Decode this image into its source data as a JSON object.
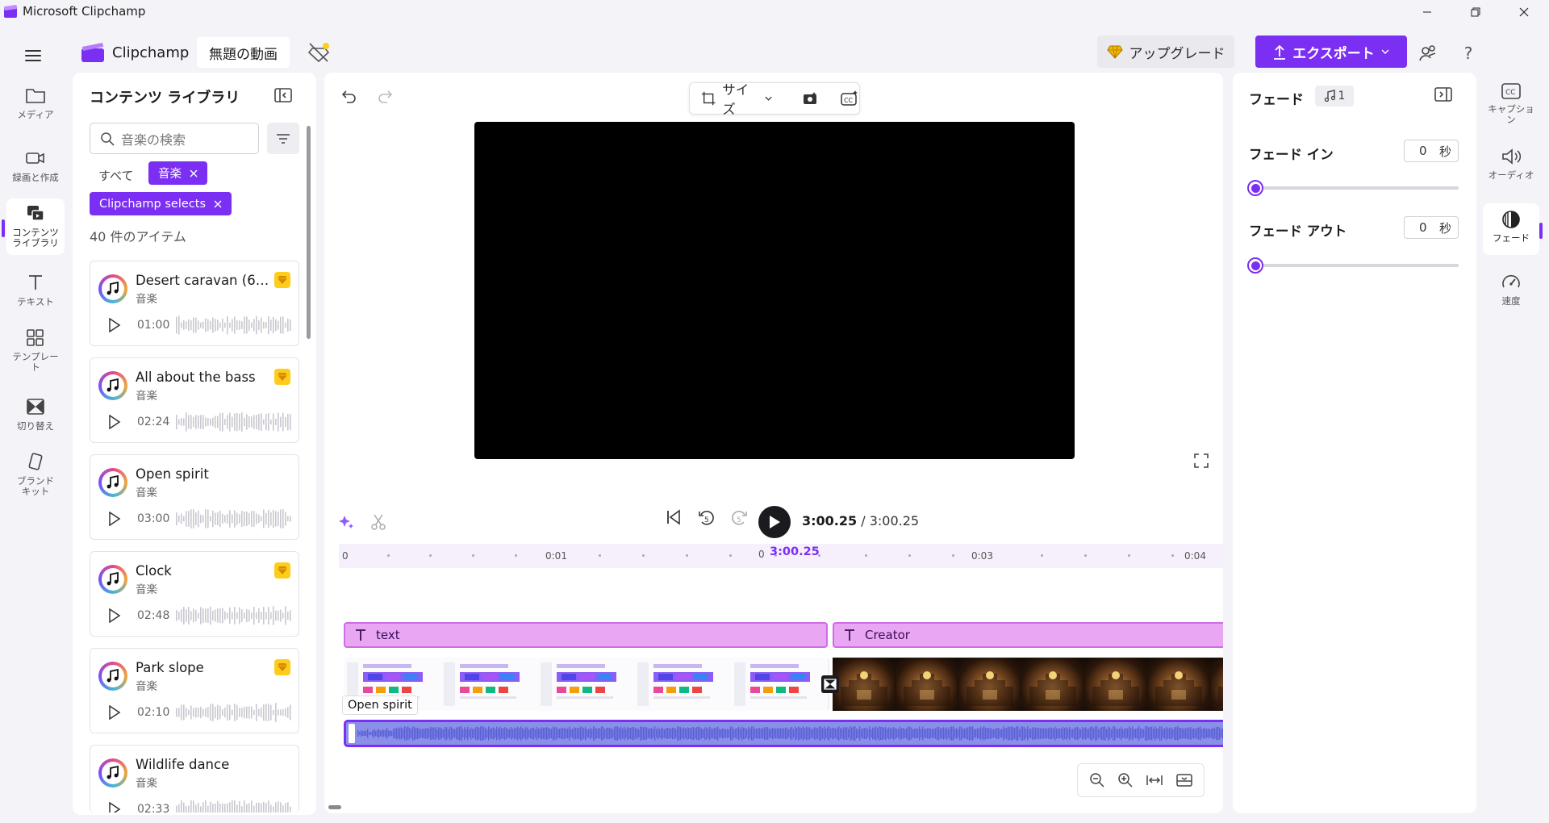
{
  "window": {
    "title": "Microsoft Clipchamp"
  },
  "header": {
    "brand": "Clipchamp",
    "project_title": "無題の動画",
    "upgrade_label": "アップグレード",
    "export_label": "エクスポート",
    "help_label": "?"
  },
  "left_nav": {
    "items": [
      {
        "label": "メディア",
        "icon": "folder-icon"
      },
      {
        "label": "録画と作成",
        "icon": "camera-icon"
      },
      {
        "label": "コンテンツ ライブラリ",
        "icon": "content-library-icon",
        "active": true
      },
      {
        "label": "テキスト",
        "icon": "text-icon"
      },
      {
        "label": "テンプレート",
        "icon": "templates-icon"
      },
      {
        "label": "切り替え",
        "icon": "transitions-icon"
      },
      {
        "label": "ブランド キット",
        "icon": "brand-kit-icon"
      }
    ]
  },
  "library": {
    "title": "コンテンツ ライブラリ",
    "search_placeholder": "音楽の検索",
    "filter_all": "すべて",
    "chips": [
      "音楽",
      "Clipchamp selects"
    ],
    "count": "40 件のアイテム",
    "items": [
      {
        "name": "Desert caravan (60 s...",
        "type": "音楽",
        "duration": "01:00",
        "premium": true
      },
      {
        "name": "All about the bass",
        "type": "音楽",
        "duration": "02:24",
        "premium": true
      },
      {
        "name": "Open spirit",
        "type": "音楽",
        "duration": "03:00",
        "premium": false
      },
      {
        "name": "Clock",
        "type": "音楽",
        "duration": "02:48",
        "premium": true
      },
      {
        "name": "Park slope",
        "type": "音楽",
        "duration": "02:10",
        "premium": true
      },
      {
        "name": "Wildlife dance",
        "type": "音楽",
        "duration": "02:33",
        "premium": false
      }
    ]
  },
  "preview": {
    "size_label": "サイズ",
    "timecode_current": "3:00.25",
    "timecode_total": "/ 3:00.25"
  },
  "timeline": {
    "ruler_labels": [
      "0",
      "0:01",
      "0:03",
      "0:04"
    ],
    "playhead_zero": "0",
    "playhead_label": "3:00.25",
    "text_clips": [
      "text",
      "Creator"
    ],
    "tooltip": "Open spirit"
  },
  "right_panel": {
    "title": "フェード",
    "chip_count": "1",
    "fade_in_label": "フェード イン",
    "fade_in_value": "0",
    "fade_out_label": "フェード アウト",
    "fade_out_value": "0",
    "unit": "秒",
    "fade_in_level": 0,
    "fade_out_level": 0
  },
  "right_nav": {
    "items": [
      {
        "label": "キャプション",
        "icon": "captions-icon"
      },
      {
        "label": "オーディオ",
        "icon": "speaker-icon"
      },
      {
        "label": "フェード",
        "icon": "fade-icon",
        "active": true
      },
      {
        "label": "速度",
        "icon": "speed-icon"
      }
    ]
  },
  "colors": {
    "accent": "#7b2ff2",
    "premium": "#ffcc1c",
    "text_clip": "#e9a7f3",
    "audio_clip": "#8a90e8"
  }
}
